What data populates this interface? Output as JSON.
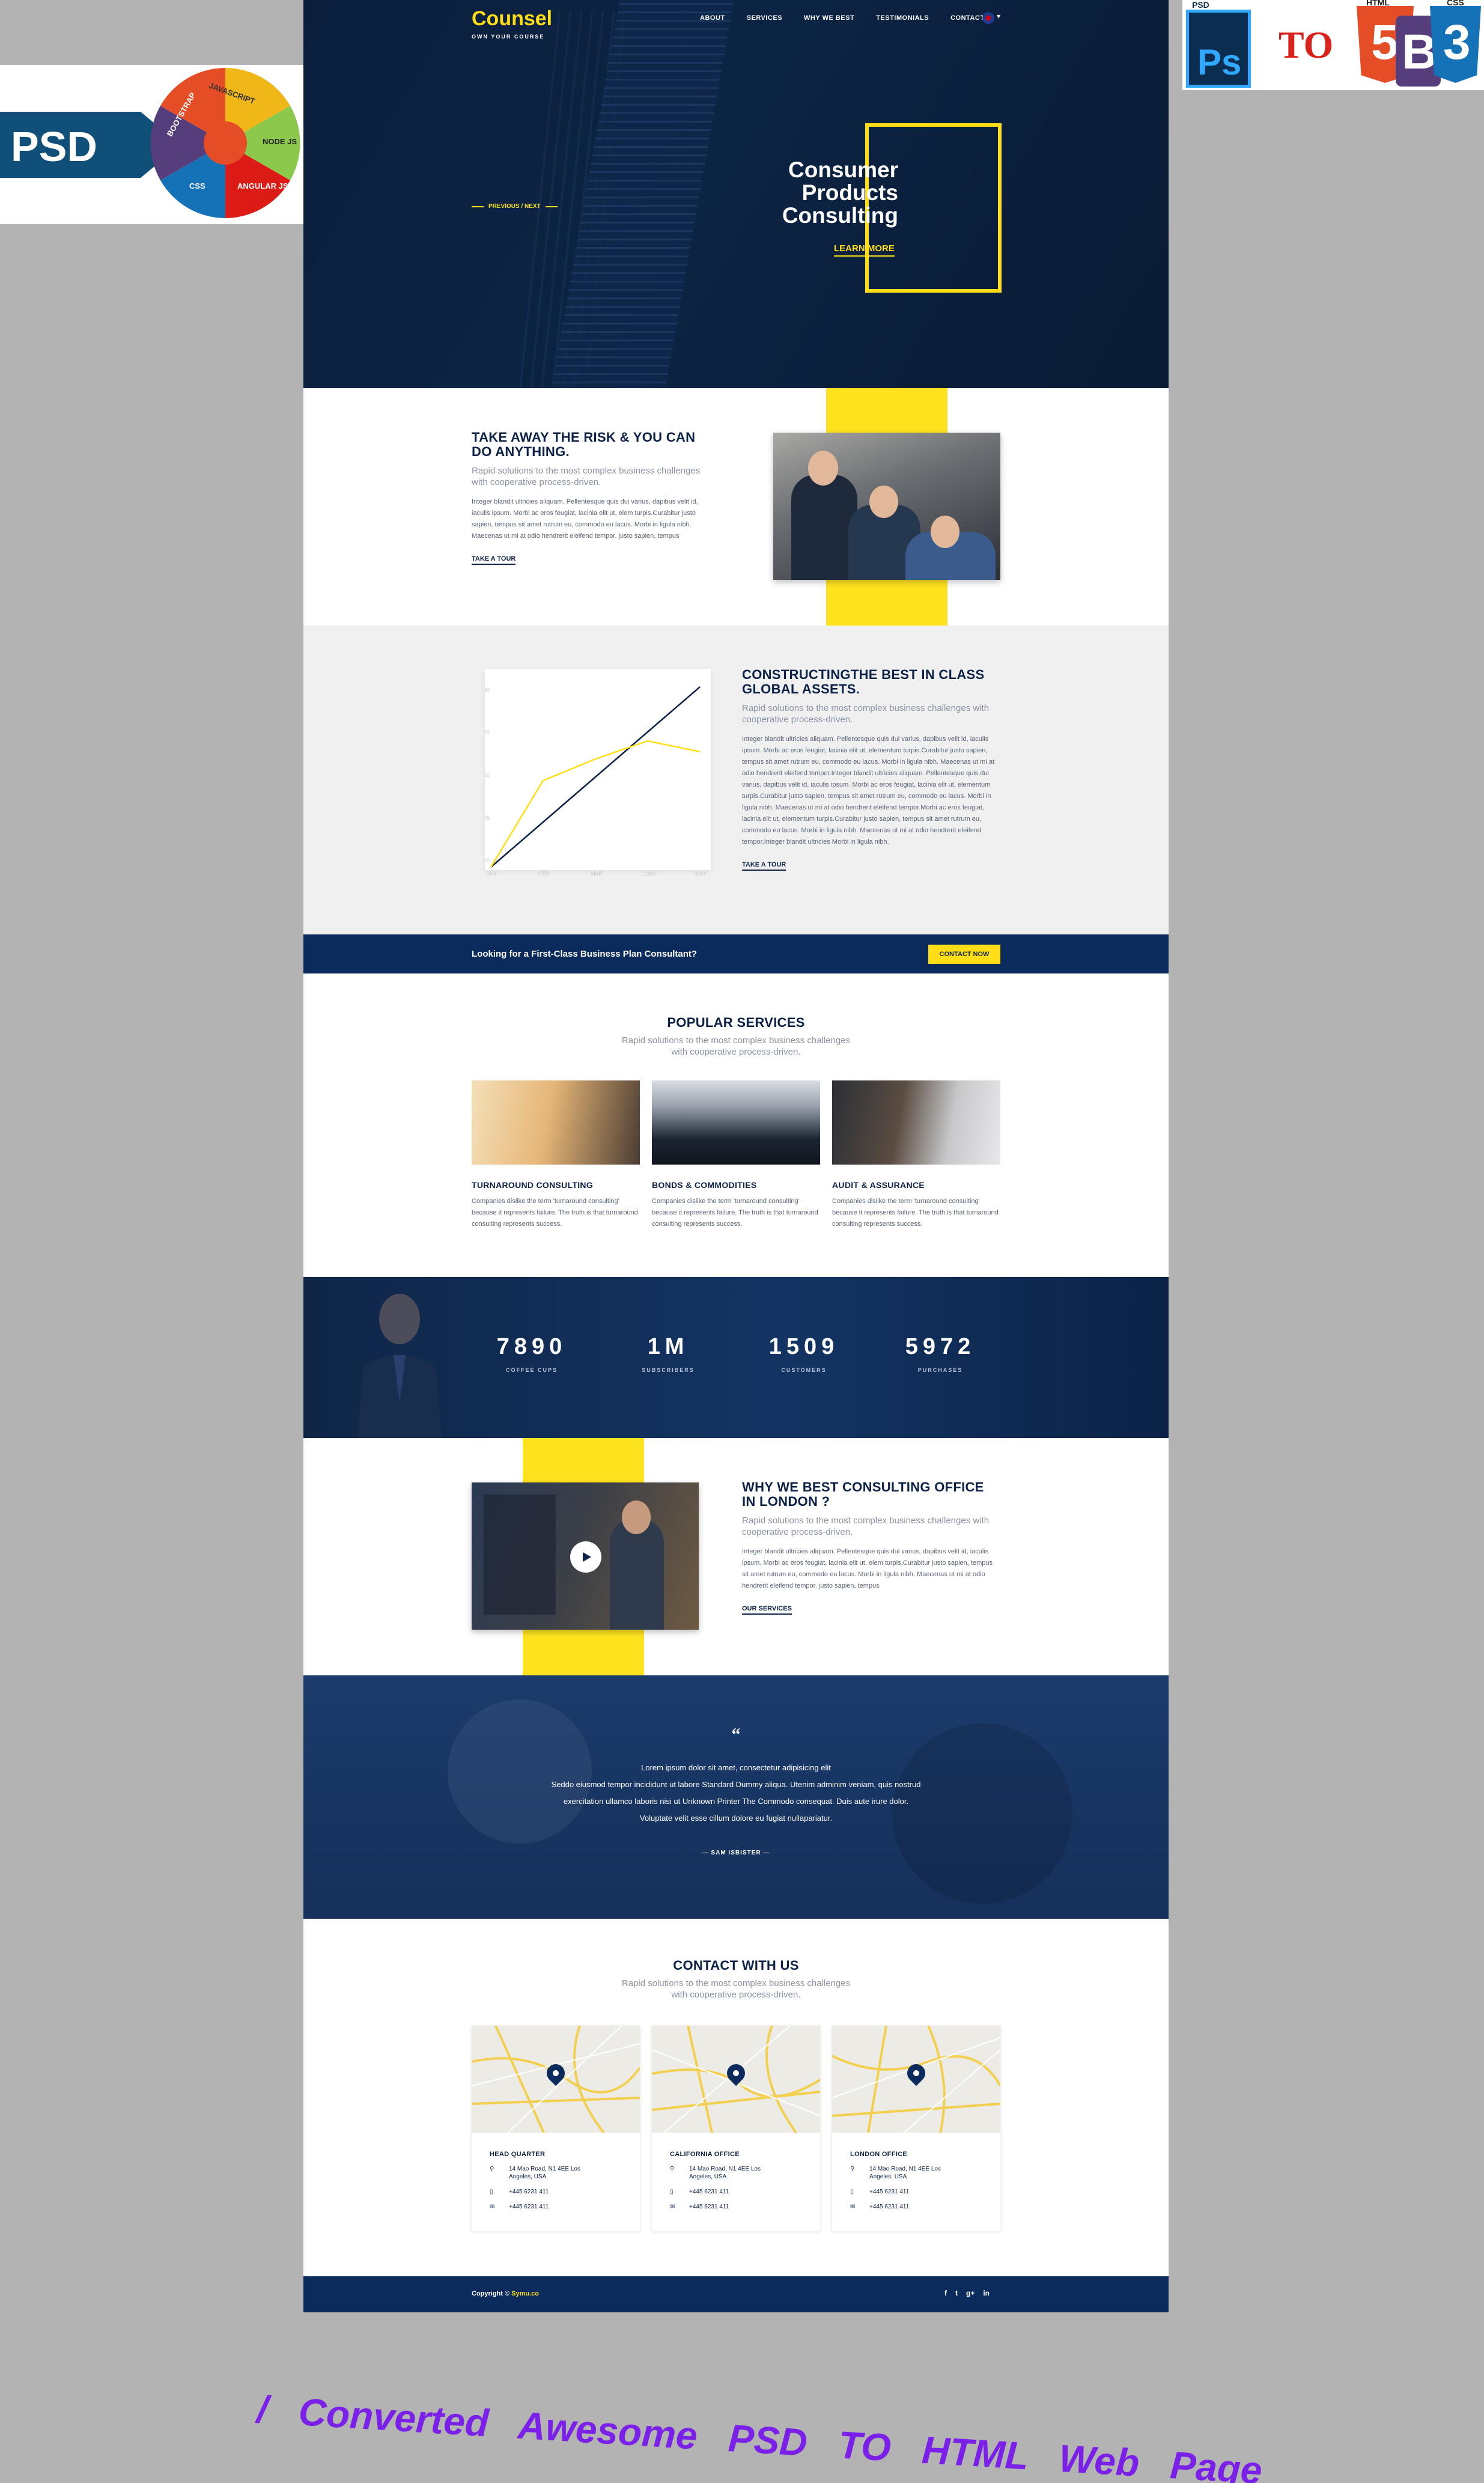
{
  "promo": {
    "left": {
      "psd": "PSD",
      "wheel_labels": [
        "JAVASCRIPT",
        "NODE JS",
        "ANGULAR JS",
        "CSS",
        "BOOTSTRAP"
      ]
    },
    "right": {
      "psd": "PSD",
      "ps": "Ps",
      "to": "TO",
      "html": "HTML",
      "css": "CSS",
      "html_glyph": "5",
      "bootstrap_glyph": "B",
      "css_glyph": "3"
    }
  },
  "header": {
    "brand": "Counsel",
    "tagline": "OWN YOUR COURSE",
    "nav": [
      "ABOUT",
      "SERVICES",
      "WHY WE BEST",
      "TESTIMONIALS",
      "CONTACT"
    ]
  },
  "hero": {
    "title": "Consumer Products Consulting",
    "cta": "LEARN MORE",
    "slider": "PREVIOUS  /  NEXT"
  },
  "risk": {
    "title": "TAKE AWAY THE RISK & YOU CAN DO ANYTHING.",
    "subtitle": "Rapid solutions to the most complex business challenges with cooperative process-driven.",
    "body": "Integer blandit ultricies aliquam. Pellentesque quis dui varius, dapibus velit id, iaculis ipsum. Morbi ac eros feugiat, lacinia elit ut, elem turpis.Curabitur justo sapien, tempus sit amet rutrum eu, commodo eu lacus. Morbi in ligula nibh. Maecenas ut mi at odio hendrerit eleifend tempor. justo sapien, tempus",
    "link": "TAKE A TOUR"
  },
  "global": {
    "title": "CONSTRUCTINGTHE  BEST IN CLASS GLOBAL ASSETS.",
    "subtitle": "Rapid solutions to the most complex business challenges with cooperative process-driven.",
    "body": "Integer blandit ultricies aliquam. Pellentesque quis dui varius, dapibus velit id, iaculis ipsum. Morbi ac eros feugiat, lacinia elit ut, elementum turpis.Curabitur justo sapien, tempus sit amet rutrum eu, commodo eu lacus. Morbi in ligula nibh. Maecenas ut mi at odio hendrerit eleifend tempor.Integer blandit ultricies aliquam. Pellentesque quis dui varius, dapibus velit id, iaculis ipsum. Morbi ac eros feugiat, lacinia elit ut, elementum turpis.Curabitur justo sapien, tempus sit amet rutrum eu, commodo eu lacus. Morbi in ligula nibh. Maecenas ut mi at odio hendrerit eleifend tempor.Morbi ac eros feugiat, lacinia elit ut, elementum turpis.Curabitur justo sapien, tempus sit amet rutrum eu, commodo eu lacus. Morbi in ligula nibh. Maecenas ut mi at odio hendrerit eleifend tempor.Integer blandit ultricies Morbi in ligula nibh.",
    "link": "TAKE A TOUR"
  },
  "chart_data": {
    "type": "line",
    "categories": [
      "JAN",
      "FEB",
      "MAR",
      "JUNE",
      "MAY"
    ],
    "ylim": [
      0,
      100
    ],
    "yticks": [
      "10",
      "25",
      "50",
      "75",
      "90"
    ],
    "series": [
      {
        "color": "#0c2247",
        "values": [
          0,
          25,
          50,
          75,
          100
        ]
      },
      {
        "color": "#ffde17",
        "values": [
          0,
          48,
          60,
          70,
          64
        ]
      }
    ]
  },
  "cta": {
    "text": "Looking for a First-Class Business Plan Consultant?",
    "button": "CONTACT NOW"
  },
  "services": {
    "title": "POPULAR SERVICES",
    "subtitle": "Rapid solutions to the most complex business challenges with cooperative process-driven.",
    "items": [
      {
        "title": "TURNAROUND CONSULTING",
        "body": "Companies dislike the term 'turnaround consulting' because it represents failure. The truth is that turnaround consulting represents success."
      },
      {
        "title": "BONDS & COMMODITIES",
        "body": "Companies dislike the term 'turnaround consulting' because it represents failure. The truth is that turnaround consulting represents success."
      },
      {
        "title": "AUDIT & ASSURANCE",
        "body": "Companies dislike the term 'turnaround consulting' because it represents failure. The truth is that turnaround consulting represents success."
      }
    ]
  },
  "stats": [
    {
      "num": "7890",
      "label": "COFFEE CUPS"
    },
    {
      "num": "1M",
      "label": "SUBSCRIBERS"
    },
    {
      "num": "1509",
      "label": "CUSTOMERS"
    },
    {
      "num": "5972",
      "label": "PURCHASES"
    }
  ],
  "why": {
    "title": "WHY  WE BEST CONSULTING OFFICE IN LONDON ?",
    "subtitle": "Rapid solutions to the most complex business challenges with cooperative process-driven.",
    "body": "Integer blandit ultricies aliquam. Pellentesque quis dui varius, dapibus velit id, iaculis ipsum. Morbi ac eros feugiat, lacinia elit ut, elem turpis.Curabitur justo sapien, tempus sit amet rutrum eu, commodo eu lacus. Morbi in ligula nibh. Maecenas ut mi at odio hendrerit eleifend tempor. justo sapien, tempus",
    "link": "OUR SERVICES"
  },
  "testimonial": {
    "mark": "“",
    "lines": [
      "Lorem ipsum dolor sit amet, consectetur adipisicing elit",
      "Seddo eiusmod tempor incididunt ut labore Standard Dummy aliqua. Utenim adminim veniam, quis nostrud",
      "exercitation ullamco laboris nisi ut Unknown Printer The Commodo consequat. Duis aute irure dolor.",
      "Voluptate velit esse cillum dolore eu fugiat nullapariatur."
    ],
    "author": "—  SAM ISBISTER  —"
  },
  "contact": {
    "title": "CONTACT WITH US",
    "subtitle": "Rapid solutions to the most complex business challenges with cooperative process-driven.",
    "offices": [
      {
        "name": "HEAD QUARTER",
        "address": "14 Mao Road, N1 4EE Los Angeles, USA",
        "phone": "+445 6231 411",
        "email": "+445 6231 411"
      },
      {
        "name": "CALIFORNIA OFFICE",
        "address": "14 Mao Road, N1 4EE Los Angeles, USA",
        "phone": "+445 6231 411",
        "email": "+445 6231 411"
      },
      {
        "name": "LONDON OFFICE",
        "address": "14 Mao Road, N1 4EE Los Angeles, USA",
        "phone": "+445 6231 411",
        "email": "+445 6231 411"
      }
    ]
  },
  "footer": {
    "copyright_prefix": "Copyright © ",
    "copyright_site": "Symu.co",
    "social": [
      "f",
      "t",
      "g+",
      "in"
    ]
  },
  "caption": "/ Converted Awesome PSD TO HTML Web Page",
  "icons": {
    "location": "map-pin-icon",
    "phone": "phone-icon",
    "email": "mail-icon",
    "play": "play-icon"
  },
  "colors": {
    "navy": "#0c2247",
    "yellow": "#ffde17",
    "footer": "#0b2b5c"
  }
}
